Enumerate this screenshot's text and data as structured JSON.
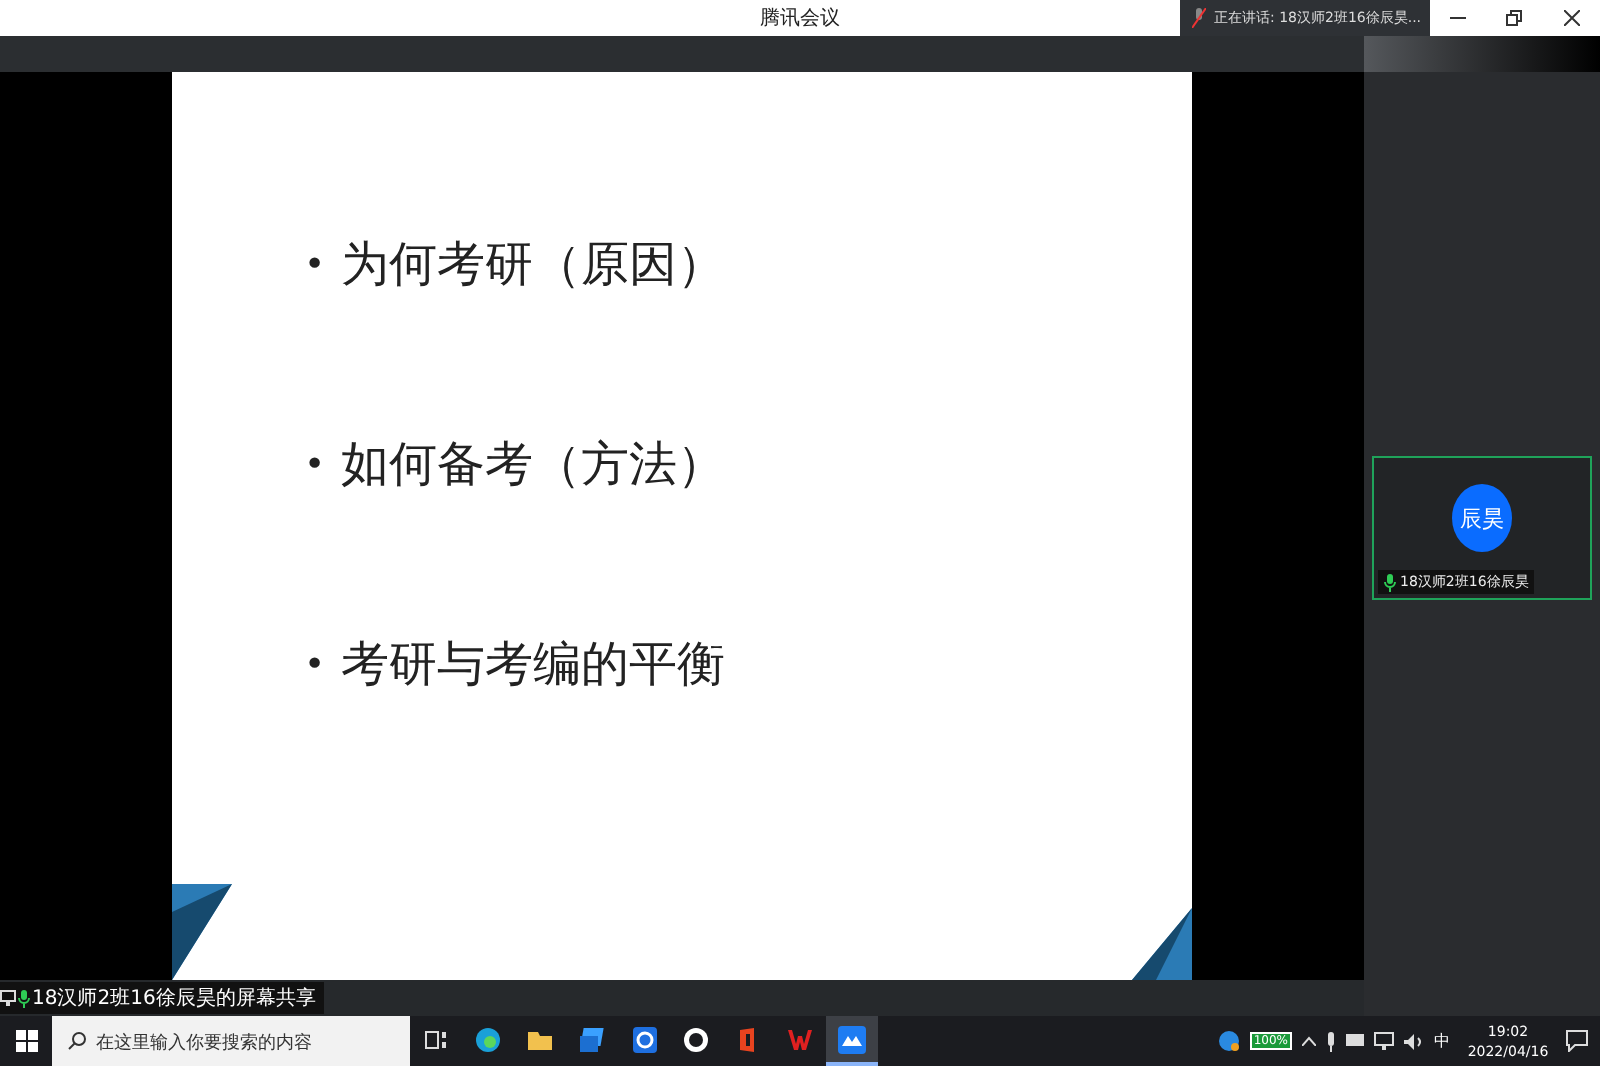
{
  "window": {
    "title": "腾讯会议",
    "speaking": "正在讲话: 18汉师2班16徐辰昊..."
  },
  "slide": {
    "bullet": "•",
    "items": [
      "为何考研（原因）",
      "如何备考（方法）",
      "考研与考编的平衡"
    ]
  },
  "share_label": "18汉师2班16徐辰昊的屏幕共享",
  "participants": [
    {
      "avatar": "辰昊",
      "name": "18汉师2班16徐辰昊",
      "mic_on": true
    }
  ],
  "taskbar": {
    "search": {
      "placeholder": "在这里输入你要搜索的内容"
    },
    "apps": [
      {
        "kind": "taskview",
        "selected": false
      },
      {
        "kind": "edge",
        "selected": false
      },
      {
        "kind": "folder",
        "selected": false
      },
      {
        "kind": "cards",
        "selected": false
      },
      {
        "kind": "note",
        "selected": false
      },
      {
        "kind": "ring",
        "selected": false
      },
      {
        "kind": "office",
        "selected": false
      },
      {
        "kind": "wps",
        "selected": false
      },
      {
        "kind": "meeting",
        "selected": true
      }
    ],
    "battery": "100%",
    "ime": "中",
    "time": "19:02",
    "date": "2022/04/16"
  }
}
